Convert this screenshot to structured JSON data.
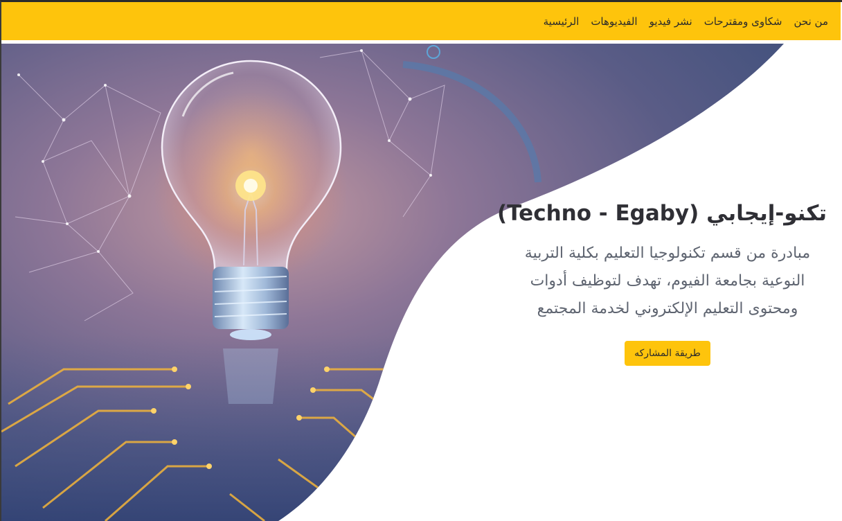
{
  "nav": {
    "items": [
      {
        "label": "الرئيسية"
      },
      {
        "label": "الفيديوهات"
      },
      {
        "label": "نشر فيديو"
      },
      {
        "label": "شكاوى ومقترحات"
      },
      {
        "label": "من نحن"
      }
    ]
  },
  "hero": {
    "title": "تكنو-إيجابي (Techno - Egaby)",
    "description": "مبادرة من قسم تكنولوجيا التعليم بكلية التربية النوعية بجامعة الفيوم، تهدف لتوظيف أدوات ومحتوى التعليم الإلكتروني لخدمة المجتمع",
    "cta_label": "طريقة المشاركه",
    "image_icon": "lightbulb-circuit-image"
  },
  "colors": {
    "accent": "#fec40c",
    "hero_overlay": "#6b5a86",
    "title": "#2f2f35",
    "text": "#5e6470"
  }
}
